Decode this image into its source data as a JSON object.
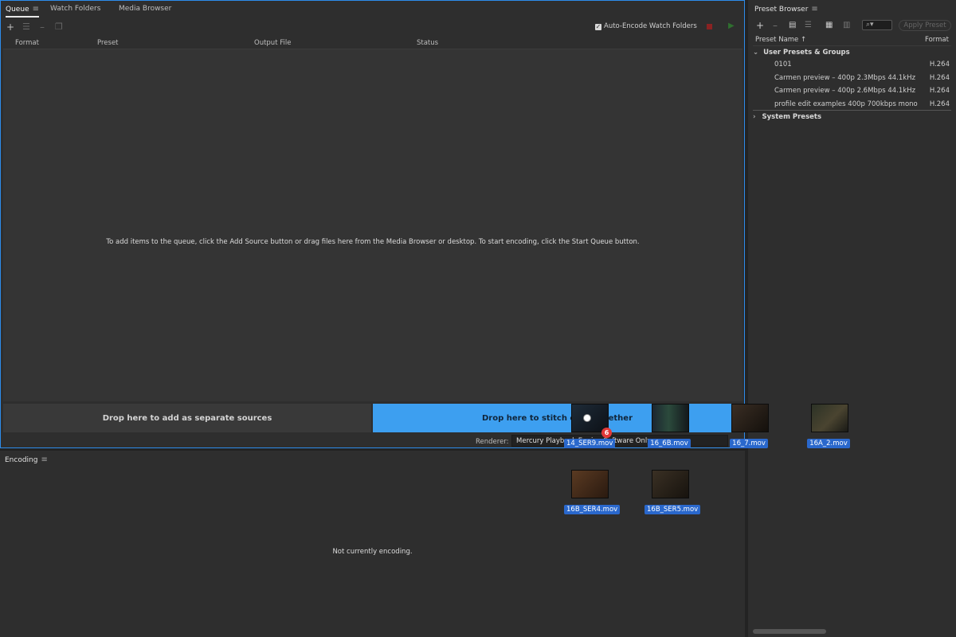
{
  "queue": {
    "tabs": [
      {
        "label": "Queue"
      },
      {
        "label": "Watch Folders"
      },
      {
        "label": "Media Browser"
      }
    ],
    "auto_encode_label": "Auto-Encode Watch Folders",
    "auto_encode_checked": true,
    "columns": [
      "Format",
      "Preset",
      "Output File",
      "Status"
    ],
    "empty_hint": "To add items to the queue, click the Add Source button or drag files here from the Media Browser or desktop.  To start encoding, click the Start Queue button.",
    "drop_separate": "Drop here to add as separate sources",
    "drop_stitch": "Drop here to stitch clips together",
    "renderer_label": "Renderer:",
    "renderer_value": "Mercury Playback Engine Software Only"
  },
  "encoding": {
    "title": "Encoding",
    "message": "Not currently encoding."
  },
  "preset_browser": {
    "title": "Preset Browser",
    "apply_label": "Apply Preset",
    "col_name": "Preset Name",
    "col_format": "Format",
    "user_group": "User Presets & Groups",
    "presets": [
      {
        "name": "0101",
        "format": "H.264"
      },
      {
        "name": "Carmen preview – 400p 2.3Mbps 44.1kHz",
        "format": "H.264"
      },
      {
        "name": "Carmen preview – 400p 2.6Mbps 44.1kHz",
        "format": "H.264"
      },
      {
        "name": "profile edit examples 400p 700kbps mono",
        "format": "H.264"
      }
    ],
    "system_group": "System Presets"
  },
  "drag": {
    "count": "6",
    "clips": [
      {
        "name": "14_SER9.mov"
      },
      {
        "name": "16_6B.mov"
      },
      {
        "name": "16_7.mov"
      },
      {
        "name": "16A_2.mov"
      },
      {
        "name": "16B_SER4.mov"
      },
      {
        "name": "16B_SER5.mov"
      }
    ]
  },
  "colors": {
    "accent": "#3d9ff0",
    "panel": "#2e2e2e",
    "selection": "#2a68cc",
    "badge": "#e03838"
  }
}
